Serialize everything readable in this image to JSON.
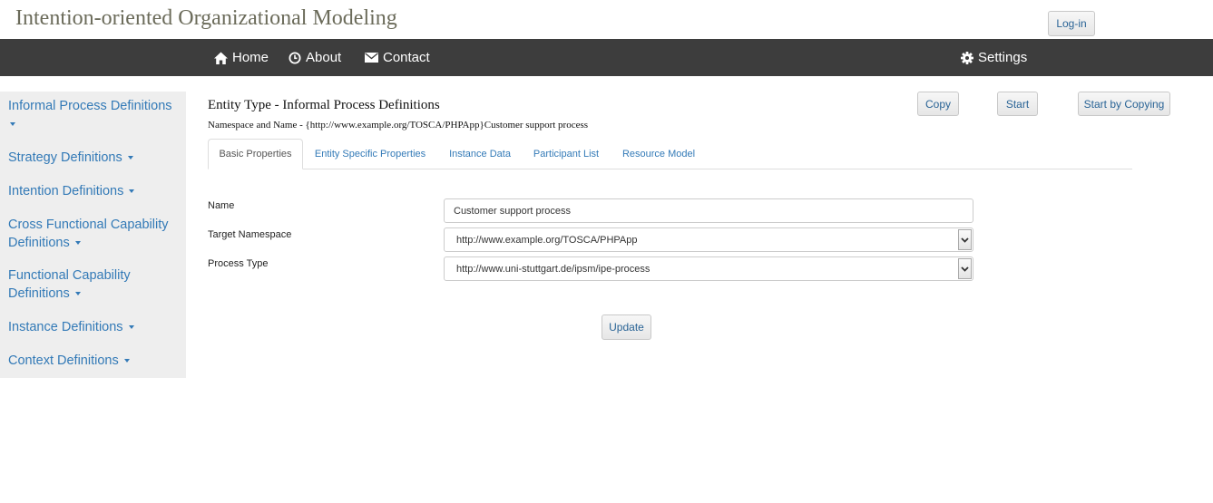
{
  "header": {
    "brand": "Intention-oriented Organizational Modeling",
    "login_label": "Log-in"
  },
  "navbar": {
    "items": [
      {
        "label": "Home",
        "icon": "home-icon"
      },
      {
        "label": "About",
        "icon": "clock-icon"
      },
      {
        "label": "Contact",
        "icon": "envelope-icon"
      }
    ],
    "settings": {
      "label": "Settings",
      "icon": "gear-icon"
    }
  },
  "sidebar": {
    "items": [
      {
        "label": "Informal Process Definitions"
      },
      {
        "label": "Strategy Definitions"
      },
      {
        "label": "Intention Definitions"
      },
      {
        "label": "Cross Functional Capability Definitions"
      },
      {
        "label": "Functional Capability Definitions"
      },
      {
        "label": "Instance Definitions"
      },
      {
        "label": "Context Definitions"
      }
    ]
  },
  "main": {
    "title": "Entity Type - Informal Process Definitions",
    "namespace_line": "Namespace and Name - {http://www.example.org/TOSCA/PHPApp}Customer support process",
    "actions": {
      "copy": "Copy",
      "start": "Start",
      "start_by_copying": "Start by Copying"
    },
    "tabs": [
      {
        "label": "Basic Properties",
        "active": true
      },
      {
        "label": "Entity Specific Properties"
      },
      {
        "label": "Instance Data"
      },
      {
        "label": "Participant List"
      },
      {
        "label": "Resource Model"
      }
    ],
    "form": {
      "name_label": "Name",
      "name_value": "Customer support process",
      "namespace_label": "Target Namespace",
      "namespace_value": "http://www.example.org/TOSCA/PHPApp",
      "process_type_label": "Process Type",
      "process_type_value": "http://www.uni-stuttgart.de/ipsm/ipe-process",
      "update_label": "Update"
    }
  },
  "colors": {
    "navbar_bg": "#3d3d3d",
    "link": "#337ab7",
    "sidebar_bg": "#eeeeee",
    "brand_text": "#6b6b5a"
  }
}
